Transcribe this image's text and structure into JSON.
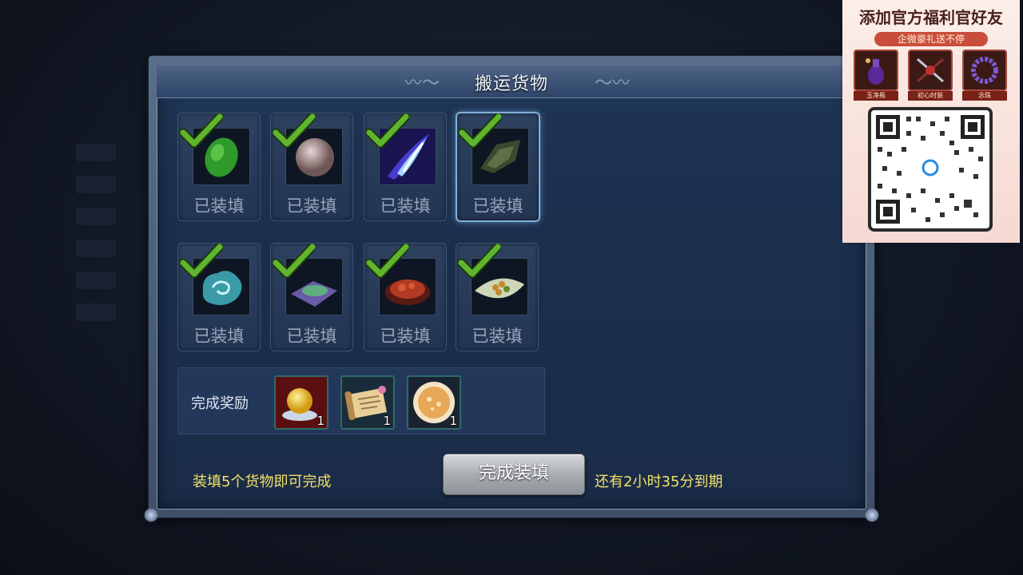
{
  "dialog": {
    "title": "搬运货物"
  },
  "slots": [
    {
      "icon": "green-gem-icon",
      "status": "已装填",
      "checked": true
    },
    {
      "icon": "pearl-icon",
      "status": "已装填",
      "checked": true
    },
    {
      "icon": "blue-feather-icon",
      "status": "已装填",
      "checked": true
    },
    {
      "icon": "dark-leaf-icon",
      "status": "已装填",
      "checked": true,
      "selected": true
    },
    {
      "icon": "blue-cloud-icon",
      "status": "已装填",
      "checked": true
    },
    {
      "icon": "tea-leaves-icon",
      "status": "已装填",
      "checked": true
    },
    {
      "icon": "red-meat-plate-icon",
      "status": "已装填",
      "checked": true
    },
    {
      "icon": "nuts-plate-icon",
      "status": "已装填",
      "checked": true
    }
  ],
  "reward": {
    "label": "完成奖励",
    "items": [
      {
        "icon": "golden-orb-icon",
        "count": "1"
      },
      {
        "icon": "scroll-icon",
        "count": "1"
      },
      {
        "icon": "pancake-icon",
        "count": "1"
      }
    ]
  },
  "footer": {
    "hint_left": "装填5个货物即可完成",
    "button_label": "完成装填",
    "hint_right": "还有2小时35分到期"
  },
  "ad": {
    "title": "添加官方福利官好友",
    "subtitle": "企微豪礼送不停",
    "prizes": [
      "玉净瓶",
      "初心时装",
      "念珠"
    ]
  },
  "colors": {
    "check_green": "#5fb52e",
    "hint_yellow": "#f1e06a",
    "panel_blue": "#1b2f4d"
  }
}
